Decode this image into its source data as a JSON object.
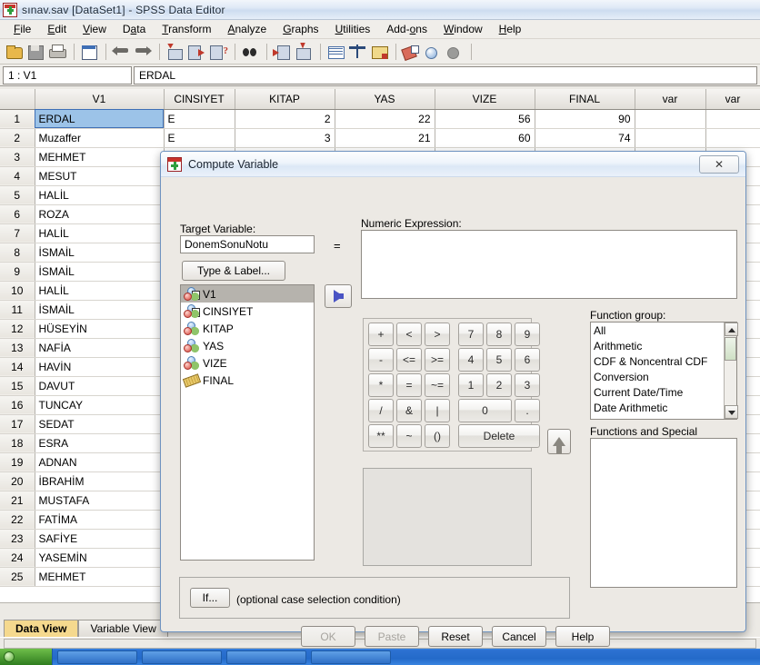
{
  "window": {
    "title": "sınav.sav [DataSet1] - SPSS Data Editor",
    "icon": "spss-app-icon"
  },
  "menubar": {
    "items": [
      "File",
      "Edit",
      "View",
      "Data",
      "Transform",
      "Analyze",
      "Graphs",
      "Utilities",
      "Add-ons",
      "Window",
      "Help"
    ]
  },
  "toolbar": {
    "icons": [
      "open-file-icon",
      "save-file-icon",
      "print-icon",
      "recall-dialogs-icon",
      "undo-icon",
      "redo-icon",
      "goto-case-icon",
      "variables-icon",
      "find-icon",
      "search-icon",
      "insert-case-icon",
      "insert-variable-icon",
      "split-file-icon",
      "weight-cases-icon",
      "select-cases-icon",
      "value-labels-icon",
      "use-sets-icon",
      "use-sets-alt-icon"
    ]
  },
  "cellbar": {
    "reference": "1 : V1",
    "value": "ERDAL"
  },
  "grid": {
    "columns": [
      "",
      "V1",
      "CINSIYET",
      "KITAP",
      "YAS",
      "VIZE",
      "FINAL",
      "var",
      "var"
    ],
    "rows": [
      {
        "n": "1",
        "v1": "ERDAL",
        "cinsiyet": "E",
        "kitap": "2",
        "yas": "22",
        "vize": "56",
        "final": "90"
      },
      {
        "n": "2",
        "v1": "Muzaffer",
        "cinsiyet": "E",
        "kitap": "3",
        "yas": "21",
        "vize": "60",
        "final": "74"
      },
      {
        "n": "3",
        "v1": "MEHMET",
        "cinsiyet": "",
        "kitap": "",
        "yas": "",
        "vize": "",
        "final": ""
      },
      {
        "n": "4",
        "v1": "MESUT",
        "cinsiyet": "",
        "kitap": "",
        "yas": "",
        "vize": "",
        "final": ""
      },
      {
        "n": "5",
        "v1": "HALİL",
        "cinsiyet": "",
        "kitap": "",
        "yas": "",
        "vize": "",
        "final": ""
      },
      {
        "n": "6",
        "v1": "ROZA",
        "cinsiyet": "",
        "kitap": "",
        "yas": "",
        "vize": "",
        "final": ""
      },
      {
        "n": "7",
        "v1": "HALİL",
        "cinsiyet": "",
        "kitap": "",
        "yas": "",
        "vize": "",
        "final": ""
      },
      {
        "n": "8",
        "v1": "İSMAİL",
        "cinsiyet": "",
        "kitap": "",
        "yas": "",
        "vize": "",
        "final": ""
      },
      {
        "n": "9",
        "v1": "İSMAİL",
        "cinsiyet": "",
        "kitap": "",
        "yas": "",
        "vize": "",
        "final": ""
      },
      {
        "n": "10",
        "v1": "HALİL",
        "cinsiyet": "",
        "kitap": "",
        "yas": "",
        "vize": "",
        "final": ""
      },
      {
        "n": "11",
        "v1": "İSMAİL",
        "cinsiyet": "",
        "kitap": "",
        "yas": "",
        "vize": "",
        "final": ""
      },
      {
        "n": "12",
        "v1": "HÜSEYİN",
        "cinsiyet": "",
        "kitap": "",
        "yas": "",
        "vize": "",
        "final": ""
      },
      {
        "n": "13",
        "v1": "NAFİA",
        "cinsiyet": "",
        "kitap": "",
        "yas": "",
        "vize": "",
        "final": ""
      },
      {
        "n": "14",
        "v1": "HAVİN",
        "cinsiyet": "",
        "kitap": "",
        "yas": "",
        "vize": "",
        "final": ""
      },
      {
        "n": "15",
        "v1": "DAVUT",
        "cinsiyet": "",
        "kitap": "",
        "yas": "",
        "vize": "",
        "final": ""
      },
      {
        "n": "16",
        "v1": "TUNCAY",
        "cinsiyet": "",
        "kitap": "",
        "yas": "",
        "vize": "",
        "final": ""
      },
      {
        "n": "17",
        "v1": "SEDAT",
        "cinsiyet": "",
        "kitap": "",
        "yas": "",
        "vize": "",
        "final": ""
      },
      {
        "n": "18",
        "v1": "ESRA",
        "cinsiyet": "",
        "kitap": "",
        "yas": "",
        "vize": "",
        "final": ""
      },
      {
        "n": "19",
        "v1": "ADNAN",
        "cinsiyet": "",
        "kitap": "",
        "yas": "",
        "vize": "",
        "final": ""
      },
      {
        "n": "20",
        "v1": "İBRAHİM",
        "cinsiyet": "",
        "kitap": "",
        "yas": "",
        "vize": "",
        "final": ""
      },
      {
        "n": "21",
        "v1": "MUSTAFA",
        "cinsiyet": "",
        "kitap": "",
        "yas": "",
        "vize": "",
        "final": ""
      },
      {
        "n": "22",
        "v1": "FATİMA",
        "cinsiyet": "",
        "kitap": "",
        "yas": "",
        "vize": "",
        "final": ""
      },
      {
        "n": "23",
        "v1": "SAFİYE",
        "cinsiyet": "",
        "kitap": "",
        "yas": "",
        "vize": "",
        "final": ""
      },
      {
        "n": "24",
        "v1": "YASEMİN",
        "cinsiyet": "",
        "kitap": "",
        "yas": "",
        "vize": "",
        "final": ""
      },
      {
        "n": "25",
        "v1": "MEHMET",
        "cinsiyet": "",
        "kitap": "",
        "yas": "",
        "vize": "",
        "final": ""
      }
    ],
    "selected_cell": "ERDAL"
  },
  "viewtabs": {
    "data_view": "Data View",
    "variable_view": "Variable View",
    "active": "Data View"
  },
  "dialog": {
    "title": "Compute Variable",
    "close_glyph": "✕",
    "target_variable_label": "Target Variable:",
    "target_variable_value": "DonemSonuNotu",
    "equals": "=",
    "type_label_button": "Type & Label...",
    "numeric_expression_label": "Numeric Expression:",
    "numeric_expression_value": "",
    "move_arrow_icon": "arrow-right-icon",
    "function_up_arrow_icon": "arrow-up-icon",
    "variables": [
      {
        "name": "V1",
        "icon": "string-nominal-icon",
        "selected": true
      },
      {
        "name": "CINSIYET",
        "icon": "string-nominal-icon",
        "selected": false
      },
      {
        "name": "KITAP",
        "icon": "nominal-icon",
        "selected": false
      },
      {
        "name": "YAS",
        "icon": "nominal-icon",
        "selected": false
      },
      {
        "name": "VIZE",
        "icon": "nominal-icon",
        "selected": false
      },
      {
        "name": "FINAL",
        "icon": "scale-ruler-icon",
        "selected": false
      }
    ],
    "keypad": [
      {
        "label": "+",
        "col": 0,
        "row": 0,
        "w": 1
      },
      {
        "label": "<",
        "col": 1,
        "row": 0,
        "w": 1
      },
      {
        "label": ">",
        "col": 2,
        "row": 0,
        "w": 1
      },
      {
        "label": "7",
        "col": 3,
        "row": 0,
        "w": 1
      },
      {
        "label": "8",
        "col": 4,
        "row": 0,
        "w": 1
      },
      {
        "label": "9",
        "col": 5,
        "row": 0,
        "w": 1
      },
      {
        "label": "-",
        "col": 0,
        "row": 1,
        "w": 1
      },
      {
        "label": "<=",
        "col": 1,
        "row": 1,
        "w": 1
      },
      {
        "label": ">=",
        "col": 2,
        "row": 1,
        "w": 1
      },
      {
        "label": "4",
        "col": 3,
        "row": 1,
        "w": 1
      },
      {
        "label": "5",
        "col": 4,
        "row": 1,
        "w": 1
      },
      {
        "label": "6",
        "col": 5,
        "row": 1,
        "w": 1
      },
      {
        "label": "*",
        "col": 0,
        "row": 2,
        "w": 1
      },
      {
        "label": "=",
        "col": 1,
        "row": 2,
        "w": 1
      },
      {
        "label": "~=",
        "col": 2,
        "row": 2,
        "w": 1
      },
      {
        "label": "1",
        "col": 3,
        "row": 2,
        "w": 1
      },
      {
        "label": "2",
        "col": 4,
        "row": 2,
        "w": 1
      },
      {
        "label": "3",
        "col": 5,
        "row": 2,
        "w": 1
      },
      {
        "label": "/",
        "col": 0,
        "row": 3,
        "w": 1
      },
      {
        "label": "&",
        "col": 1,
        "row": 3,
        "w": 1
      },
      {
        "label": "|",
        "col": 2,
        "row": 3,
        "w": 1
      },
      {
        "label": "0",
        "col": 3,
        "row": 3,
        "w": 2
      },
      {
        "label": ".",
        "col": 5,
        "row": 3,
        "w": 1
      },
      {
        "label": "**",
        "col": 0,
        "row": 4,
        "w": 1
      },
      {
        "label": "~",
        "col": 1,
        "row": 4,
        "w": 1
      },
      {
        "label": "()",
        "col": 2,
        "row": 4,
        "w": 1
      },
      {
        "label": "Delete",
        "col": 3,
        "row": 4,
        "w": 3
      }
    ],
    "function_group_label": "Function group:",
    "function_groups": [
      "All",
      "Arithmetic",
      "CDF & Noncentral CDF",
      "Conversion",
      "Current Date/Time",
      "Date Arithmetic"
    ],
    "functions_label": "Functions and Special Variables:",
    "functions": [],
    "if_button": "If...",
    "if_hint": "(optional case selection condition)",
    "buttons": [
      {
        "label": "OK",
        "disabled": true
      },
      {
        "label": "Paste",
        "disabled": true
      },
      {
        "label": "Reset",
        "disabled": false
      },
      {
        "label": "Cancel",
        "disabled": false
      },
      {
        "label": "Help",
        "disabled": false
      }
    ]
  },
  "taskbar": {
    "start_icon": "windows-start-orb"
  }
}
